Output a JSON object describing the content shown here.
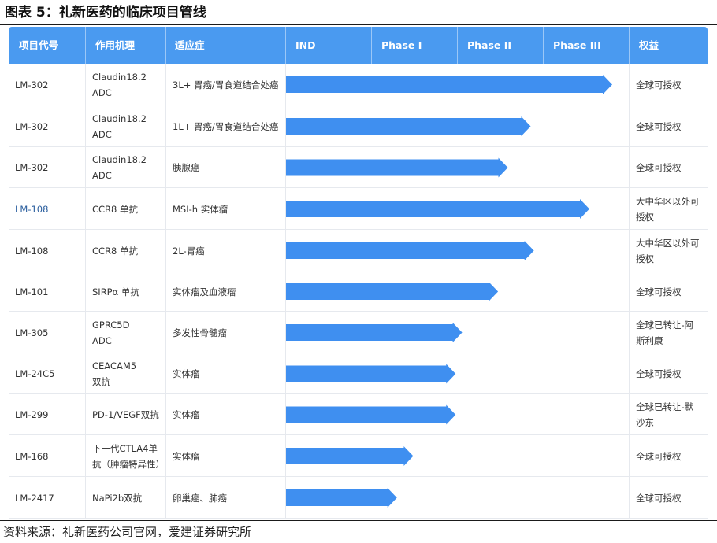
{
  "title": "图表 5：礼新医药的临床项目管线",
  "source": "资料来源：礼新医药公司官网，爱建证券研究所",
  "colors": {
    "header_bg": "#4a9af0",
    "bar": "#3f8ff0",
    "highlight_code": "#2a5e9e"
  },
  "columns": [
    "项目代号",
    "作用机理",
    "适应症",
    "IND",
    "Phase I",
    "Phase II",
    "Phase III",
    "权益"
  ],
  "phases": [
    "IND",
    "Phase I",
    "Phase II",
    "Phase III"
  ],
  "rows": [
    {
      "code": "LM-302",
      "mechanism": "Claudin18.2\nADC",
      "indication": "3L+ 胃癌/胃食道结合处癌",
      "progress": 1.0,
      "rights": "全球可授权"
    },
    {
      "code": "LM-302",
      "mechanism": "Claudin18.2\nADC",
      "indication": "1L+ 胃癌/胃食道结合处癌",
      "progress": 0.75,
      "rights": "全球可授权"
    },
    {
      "code": "LM-302",
      "mechanism": "Claudin18.2\nADC",
      "indication": "胰腺癌",
      "progress": 0.68,
      "rights": "全球可授权"
    },
    {
      "code": "LM-108",
      "mechanism": "CCR8 单抗",
      "indication": "MSI-h 实体瘤",
      "progress": 0.93,
      "rights": "大中华区以外可\n授权",
      "highlight": true
    },
    {
      "code": "LM-108",
      "mechanism": "CCR8 单抗",
      "indication": "2L-胃癌",
      "progress": 0.76,
      "rights": "大中华区以外可\n授权"
    },
    {
      "code": "LM-101",
      "mechanism": "SIRPα 单抗",
      "indication": "实体瘤及血液瘤",
      "progress": 0.65,
      "rights": "全球可授权"
    },
    {
      "code": "LM-305",
      "mechanism": "GPRC5D\nADC",
      "indication": "多发性骨髓瘤",
      "progress": 0.54,
      "rights": "全球已转让-阿\n斯利康"
    },
    {
      "code": "LM-24C5",
      "mechanism": "CEACAM5\n双抗",
      "indication": "实体瘤",
      "progress": 0.52,
      "rights": "全球可授权"
    },
    {
      "code": "LM-299",
      "mechanism": "PD-1/VEGF双抗",
      "indication": "实体瘤",
      "progress": 0.52,
      "rights": "全球已转让-默\n沙东"
    },
    {
      "code": "LM-168",
      "mechanism": "下一代CTLA4单\n抗（肿瘤特异性）",
      "indication": "实体瘤",
      "progress": 0.39,
      "rights": "全球可授权"
    },
    {
      "code": "LM-2417",
      "mechanism": "NaPi2b双抗",
      "indication": "卵巢癌、肺癌",
      "progress": 0.34,
      "rights": "全球可授权"
    }
  ]
}
